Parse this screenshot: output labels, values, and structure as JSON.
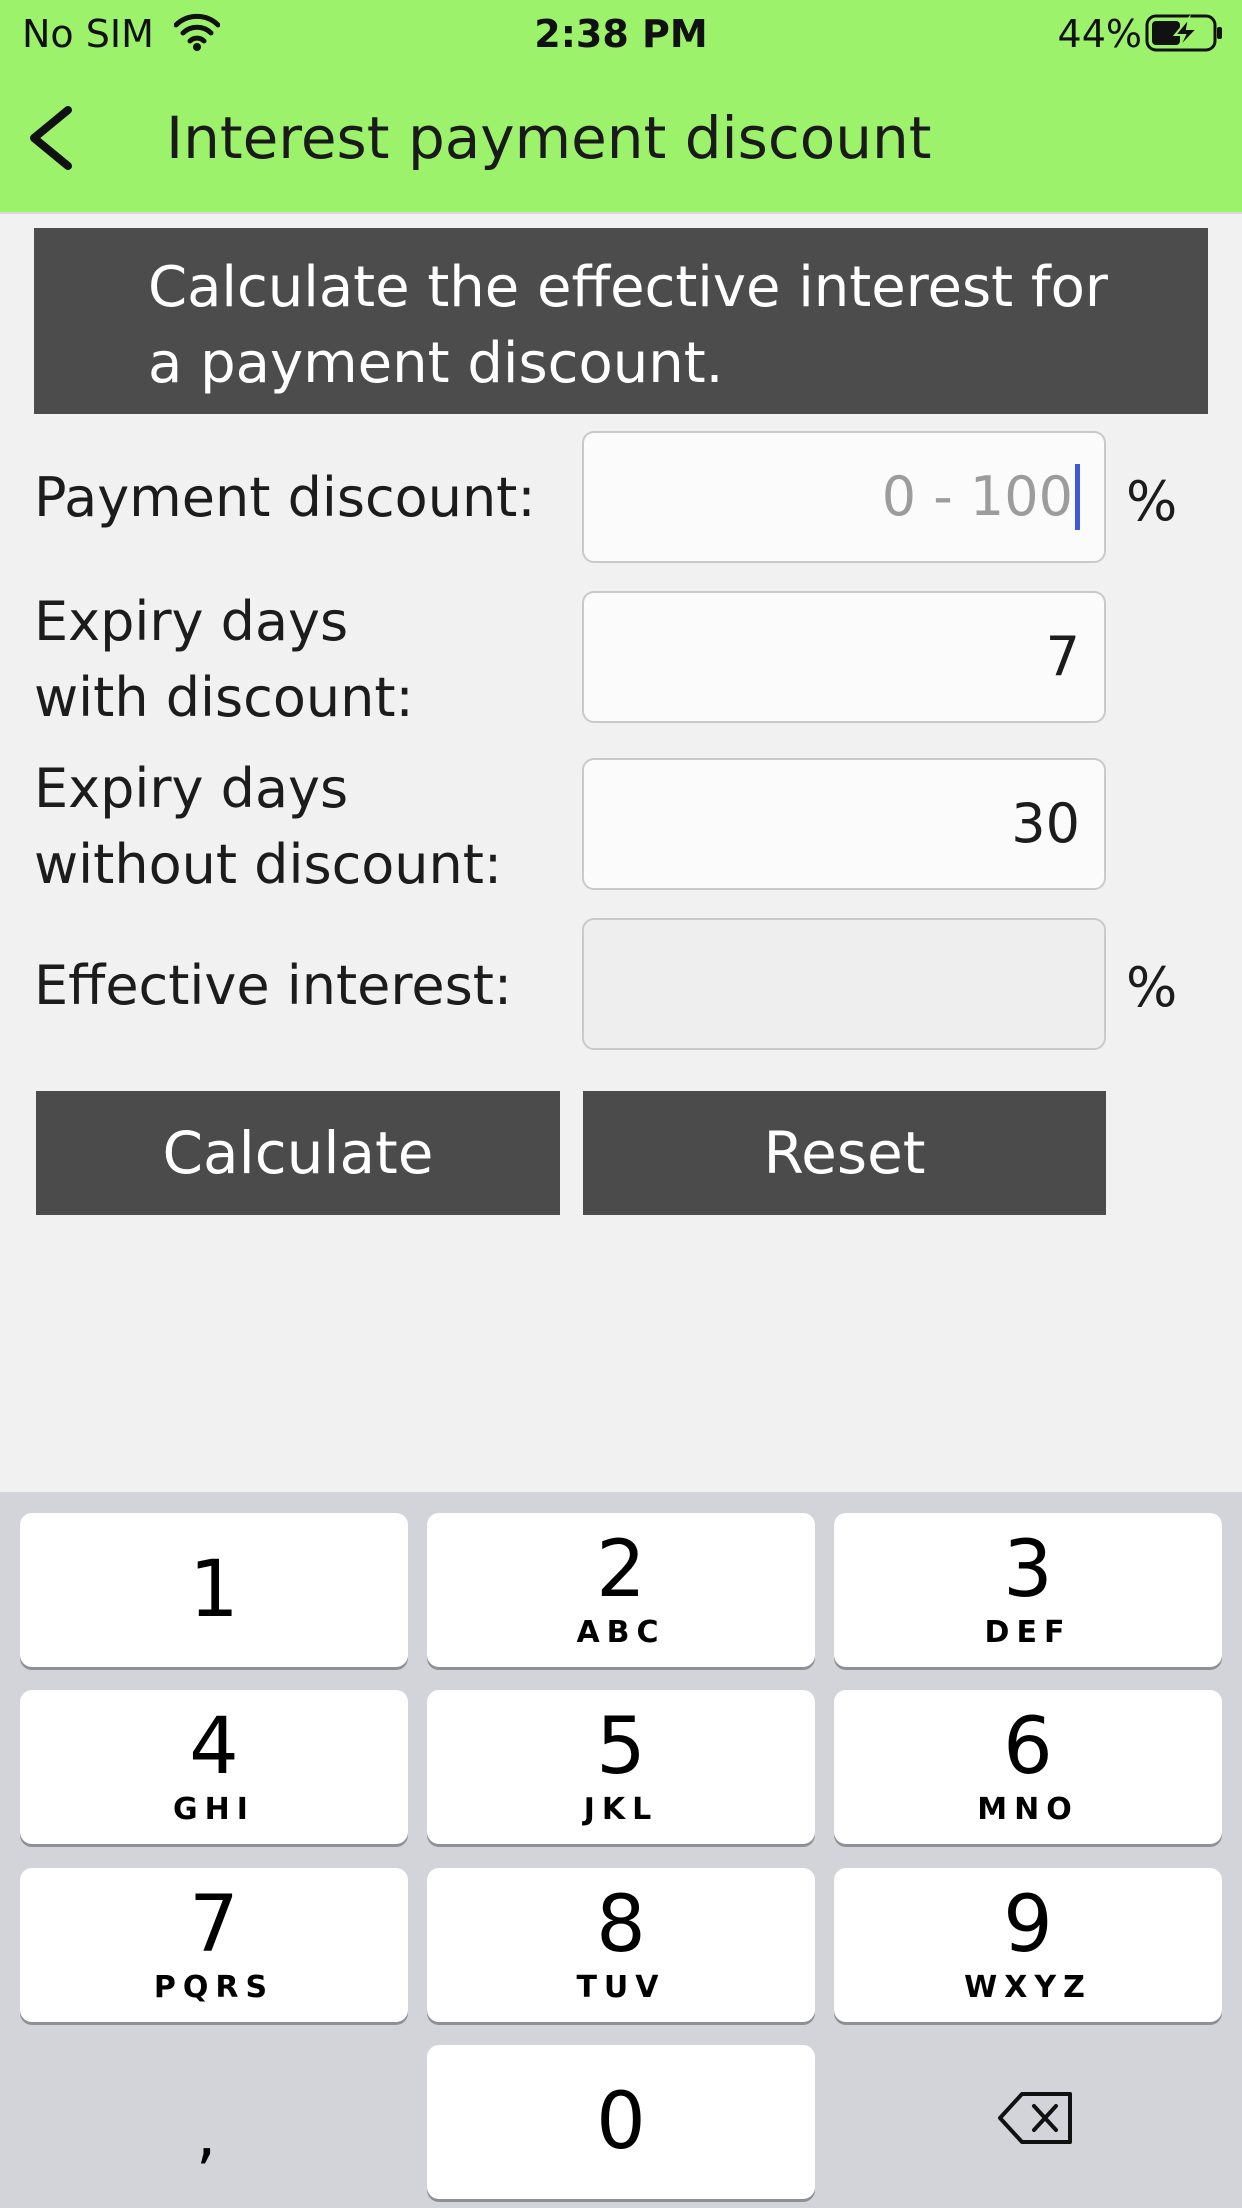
{
  "status_bar": {
    "carrier": "No SIM",
    "time": "2:38 PM",
    "battery": "44%"
  },
  "header": {
    "title": "Interest payment discount"
  },
  "description": "Calculate the effective interest for a payment discount.",
  "form": {
    "payment_discount": {
      "label": "Payment discount:",
      "value": "",
      "placeholder": "0 - 100",
      "unit": "%"
    },
    "expiry_with": {
      "label": "Expiry days\nwith discount:",
      "value": "7"
    },
    "expiry_without": {
      "label": "Expiry days\nwithout discount:",
      "value": "30"
    },
    "effective_interest": {
      "label": "Effective interest:",
      "value": "",
      "unit": "%"
    }
  },
  "buttons": {
    "calculate": "Calculate",
    "reset": "Reset"
  },
  "keypad": {
    "keys": [
      {
        "digit": "1",
        "letters": ""
      },
      {
        "digit": "2",
        "letters": "ABC"
      },
      {
        "digit": "3",
        "letters": "DEF"
      },
      {
        "digit": "4",
        "letters": "GHI"
      },
      {
        "digit": "5",
        "letters": "JKL"
      },
      {
        "digit": "6",
        "letters": "MNO"
      },
      {
        "digit": "7",
        "letters": "PQRS"
      },
      {
        "digit": "8",
        "letters": "TUV"
      },
      {
        "digit": "9",
        "letters": "WXYZ"
      },
      {
        "digit": "0",
        "letters": ""
      }
    ],
    "decimal": ","
  },
  "icons": [
    "wifi-icon",
    "battery-charging-icon",
    "back-chevron-icon",
    "delete-backspace-icon"
  ],
  "colors": {
    "header_bg": "#9cf36b",
    "banner_bg": "#4c4c4c",
    "button_bg": "#4b4b4b",
    "keyboard_bg": "#d2d4d9",
    "caret": "#3d5bd8"
  }
}
